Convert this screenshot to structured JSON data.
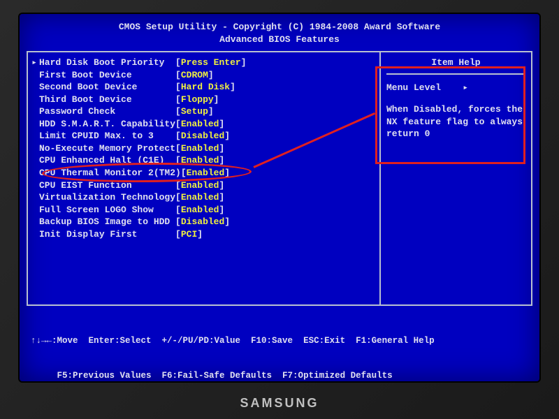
{
  "header": {
    "line1": "CMOS Setup Utility - Copyright (C) 1984-2008 Award Software",
    "line2": "Advanced BIOS Features"
  },
  "menu": [
    {
      "label": "Hard Disk Boot Priority",
      "value": "Press Enter",
      "selected": true
    },
    {
      "label": "First Boot Device",
      "value": "CDROM"
    },
    {
      "label": "Second Boot Device",
      "value": "Hard Disk"
    },
    {
      "label": "Third Boot Device",
      "value": "Floppy"
    },
    {
      "label": "Password Check",
      "value": "Setup"
    },
    {
      "label": "HDD S.M.A.R.T. Capability",
      "value": "Enabled"
    },
    {
      "label": "Limit CPUID Max. to 3",
      "value": "Disabled"
    },
    {
      "label": "No-Execute Memory Protect",
      "value": "Enabled"
    },
    {
      "label": "CPU Enhanced Halt (C1E)",
      "value": "Enabled"
    },
    {
      "label": "CPU Thermal Monitor 2(TM2)",
      "value": "Enabled"
    },
    {
      "label": "CPU EIST Function",
      "value": "Enabled"
    },
    {
      "label": "Virtualization Technology",
      "value": "Enabled"
    },
    {
      "label": "Full Screen LOGO Show",
      "value": "Enabled"
    },
    {
      "label": "Backup BIOS Image to HDD",
      "value": "Disabled"
    },
    {
      "label": "Init Display First",
      "value": "PCI"
    }
  ],
  "help": {
    "title": "Item Help",
    "menu_level_label": "Menu Level",
    "menu_level_icon": "▸",
    "description": "When Disabled, forces the NX feature flag to always return 0"
  },
  "footer": {
    "line1": "↑↓→←:Move  Enter:Select  +/-/PU/PD:Value  F10:Save  ESC:Exit  F1:General Help",
    "line2": "     F5:Previous Values  F6:Fail-Safe Defaults  F7:Optimized Defaults"
  },
  "brand": "SAMSUNG",
  "highlight_item_index": 7,
  "layout": {
    "label_width_chars": 25
  }
}
